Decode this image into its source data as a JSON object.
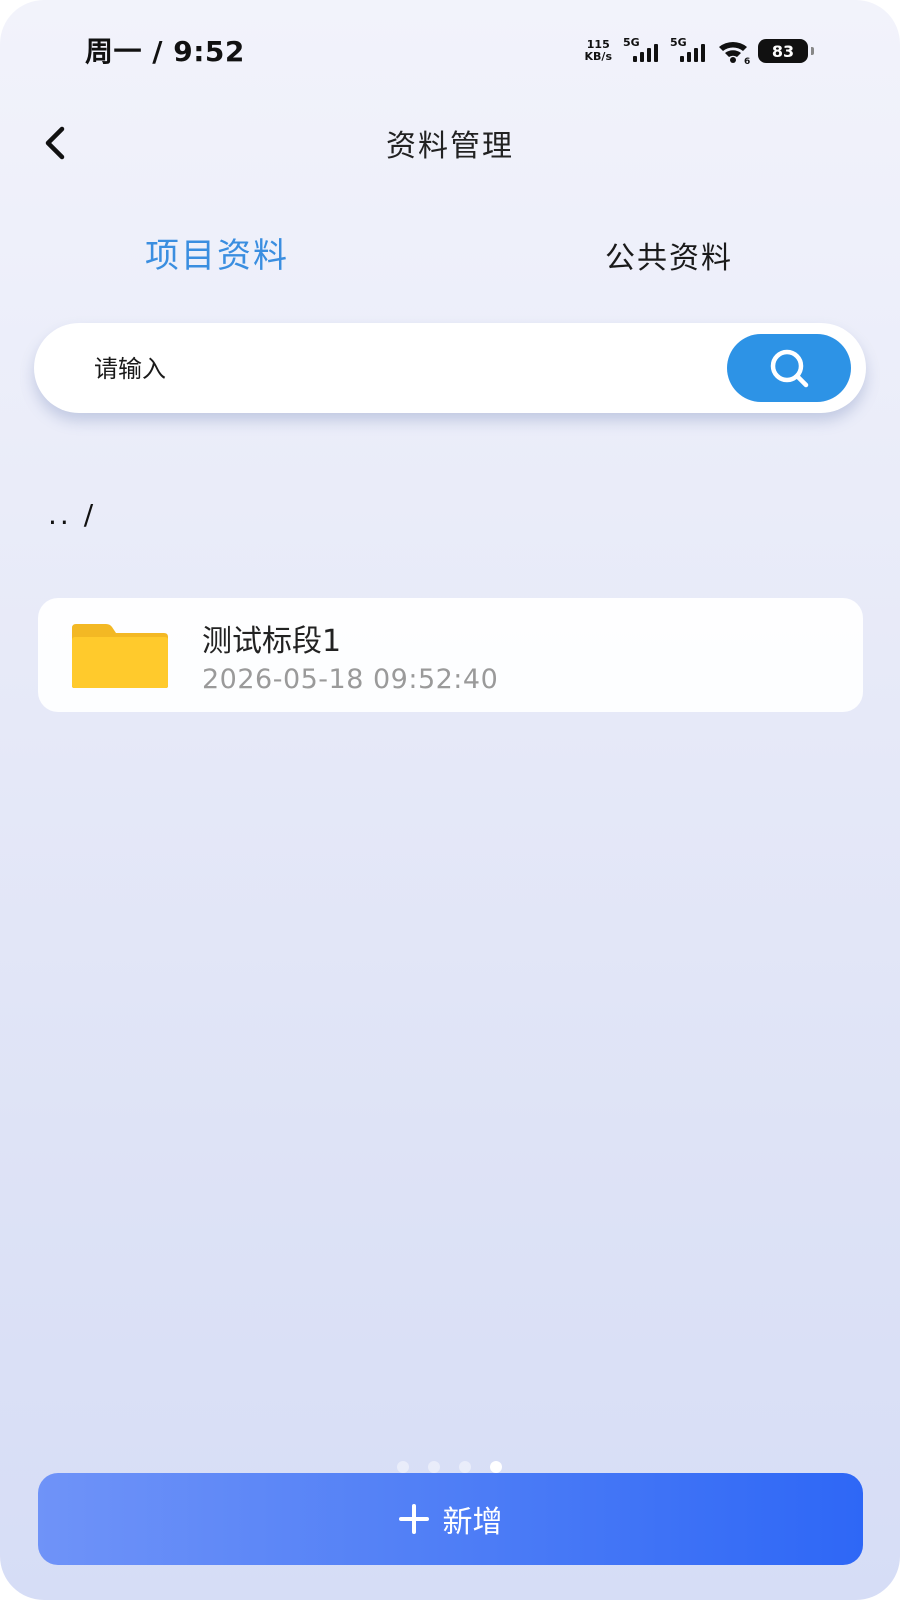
{
  "status_bar": {
    "time": "周一 / 9:52",
    "net_speed_value": "115",
    "net_speed_unit": "KB/s",
    "sim1_label": "5G",
    "sim2_label": "5G",
    "wifi_label": "6",
    "battery": "83"
  },
  "header": {
    "title": "资料管理",
    "back_icon": "chevron-left-icon"
  },
  "tabs": [
    {
      "label": "项目资料",
      "active": true,
      "color": "#3a8ee0"
    },
    {
      "label": "公共资料",
      "active": false,
      "color": "#1a1a1a"
    }
  ],
  "search": {
    "placeholder": "请输入",
    "value": "",
    "button_icon": "search-icon",
    "button_color": "#2d93e6"
  },
  "breadcrumb": ".. /",
  "files": [
    {
      "icon": "folder-icon",
      "name": "测试标段1",
      "date": "2026-05-18 09:52:40"
    }
  ],
  "pager": {
    "count": 4,
    "active_index": 3
  },
  "add_button": {
    "label": "新增",
    "icon": "plus-icon",
    "color_start": "#6f93f8",
    "color_end": "#2e67f6"
  }
}
